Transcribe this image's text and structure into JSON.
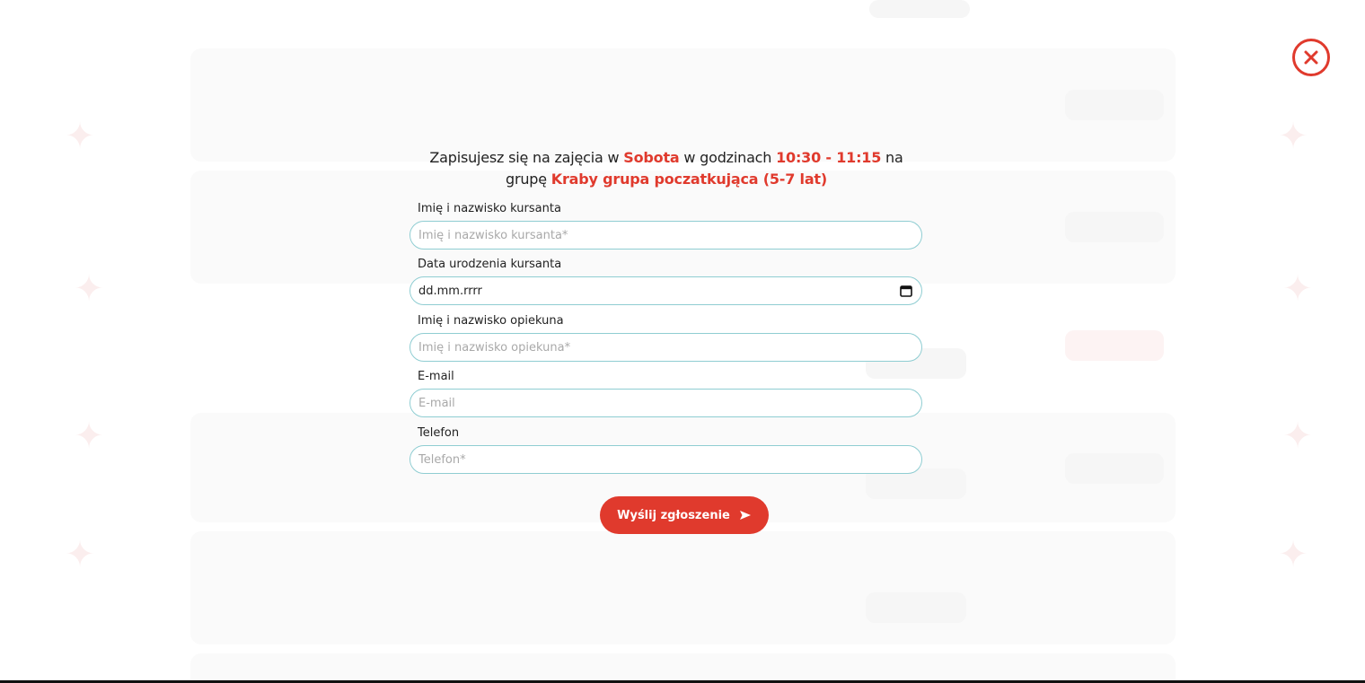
{
  "modal": {
    "intro_prefix": "Zapisujesz się na zajęcia w",
    "day": "Sobota",
    "intro_middle": "w godzinach",
    "time": "10:30 - 11:15",
    "intro_group": "na grupę",
    "group_name": "Kraby grupa poczatkująca (5-7 lat)"
  },
  "form": {
    "student_name": {
      "label": "Imię i nazwisko kursanta",
      "placeholder": "Imię i nazwisko kursanta*"
    },
    "birth_date": {
      "label": "Data urodzenia kursanta",
      "value": "dd.mm.rrrr"
    },
    "guardian_name": {
      "label": "Imię i nazwisko opiekuna",
      "placeholder": "Imię i nazwisko opiekuna*"
    },
    "email": {
      "label": "E-mail",
      "placeholder": "E-mail"
    },
    "phone": {
      "label": "Telefon",
      "placeholder": "Telefon*"
    },
    "submit_label": "Wyślij zgłoszenie"
  },
  "colors": {
    "accent": "#e03a2d",
    "field_border": "#8fcdd2"
  },
  "icons": {
    "close": "close-circle-icon",
    "calendar": "calendar-icon",
    "send": "send-icon"
  }
}
